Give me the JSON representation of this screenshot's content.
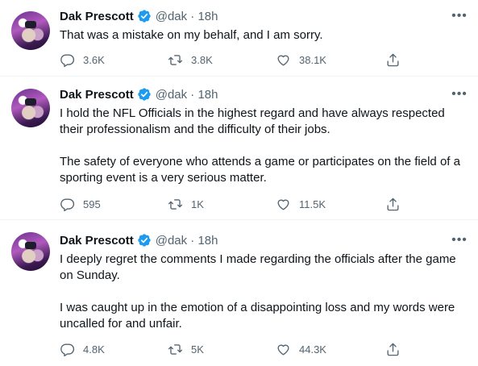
{
  "colors": {
    "text": "#0f1419",
    "secondary": "#536471",
    "verified": "#1d9bf0",
    "divider": "#eff3f4"
  },
  "icons": {
    "verified": "verified-badge-icon",
    "more": "more-options-icon",
    "reply": "reply-icon",
    "retweet": "retweet-icon",
    "like": "heart-icon",
    "share": "share-icon"
  },
  "tweets": [
    {
      "name": "Dak Prescott",
      "handle": "@dak · 18h",
      "paragraphs": [
        "That was a mistake on my behalf, and I am sorry."
      ],
      "replies": "3.6K",
      "retweets": "3.8K",
      "likes": "38.1K"
    },
    {
      "name": "Dak Prescott",
      "handle": "@dak · 18h",
      "paragraphs": [
        "I hold the NFL Officials in the highest regard and have always respected their professionalism and the difficulty of their jobs.",
        "The safety of everyone who attends a game or participates on the field of a sporting event is a very serious matter."
      ],
      "replies": "595",
      "retweets": "1K",
      "likes": "11.5K"
    },
    {
      "name": "Dak Prescott",
      "handle": "@dak · 18h",
      "paragraphs": [
        "I deeply regret the comments I made regarding the officials after the game on Sunday.",
        "I was caught up in the emotion of a disappointing loss and my words were uncalled for and unfair."
      ],
      "replies": "4.8K",
      "retweets": "5K",
      "likes": "44.3K"
    }
  ]
}
